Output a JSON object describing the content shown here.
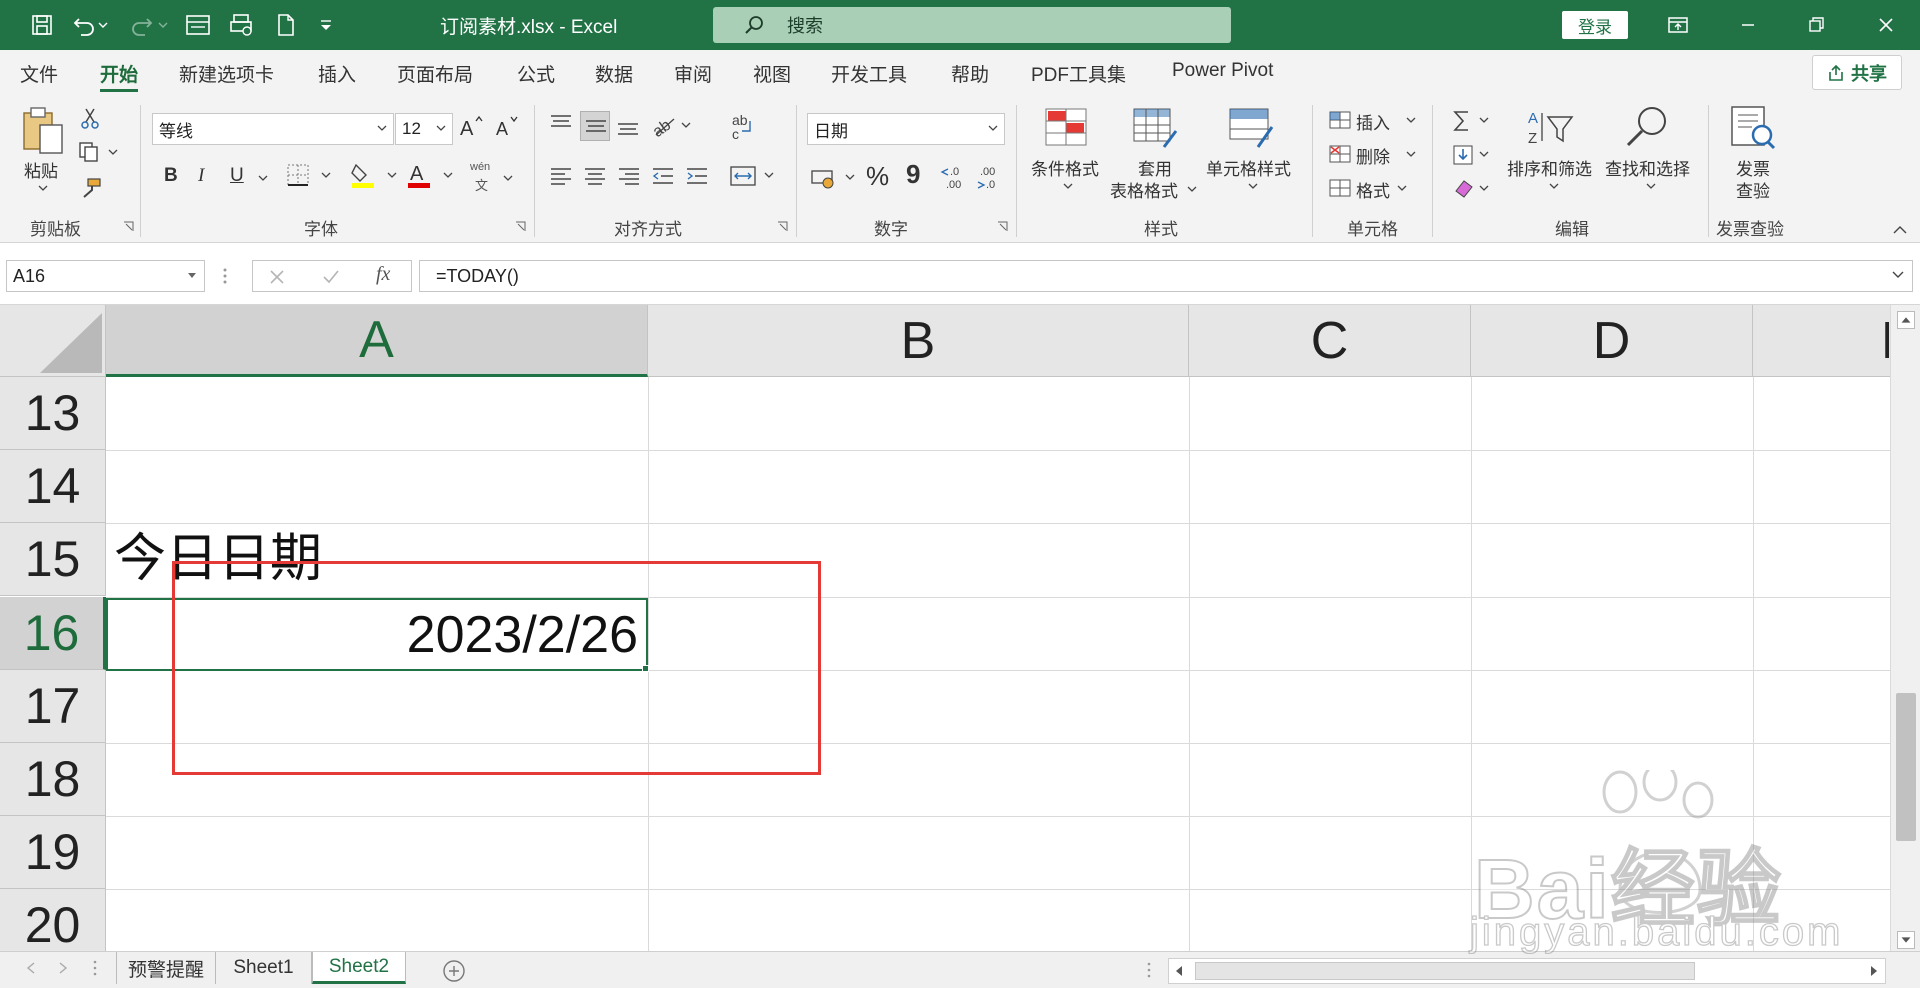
{
  "titlebar": {
    "title": "订阅素材.xlsx  -  Excel",
    "search_placeholder": "搜索",
    "login_label": "登录"
  },
  "tabs": [
    "文件",
    "开始",
    "新建选项卡",
    "插入",
    "页面布局",
    "公式",
    "数据",
    "审阅",
    "视图",
    "开发工具",
    "帮助",
    "PDF工具集",
    "Power Pivot"
  ],
  "active_tab": "开始",
  "share_label": "共享",
  "ribbon": {
    "clipboard": {
      "paste": "粘贴",
      "group": "剪贴板"
    },
    "font": {
      "name": "等线",
      "size": "12",
      "bold": "B",
      "italic": "I",
      "underline": "U",
      "font_color_glyph": "A",
      "wen": "wén",
      "wen_sub": "文",
      "group": "字体"
    },
    "alignment": {
      "group": "对齐方式"
    },
    "number": {
      "format": "日期",
      "percent": "%",
      "comma": "9",
      "group": "数字"
    },
    "styles": {
      "conditional": "条件格式",
      "table1": "套用",
      "table2": "表格格式",
      "cell_styles": "单元格样式",
      "group": "样式"
    },
    "cells": {
      "insert": "插入",
      "delete": "删除",
      "format": "格式",
      "group": "单元格"
    },
    "editing": {
      "sort": "排序和筛选",
      "find": "查找和选择",
      "group": "编辑"
    },
    "invoice": {
      "line1": "发票",
      "line2": "查验",
      "group": "发票查验"
    }
  },
  "formula_bar": {
    "name_box": "A16",
    "formula": "=TODAY()",
    "fx": "fx"
  },
  "grid": {
    "columns": [
      "A",
      "B",
      "C",
      "D",
      "E"
    ],
    "rows": [
      "13",
      "14",
      "15",
      "16",
      "17",
      "18",
      "19",
      "20"
    ],
    "selected_cell": "A16",
    "cells": {
      "A15": "今日日期",
      "A16": "2023/2/26"
    }
  },
  "sheets": [
    "预警提醒",
    "Sheet1",
    "Sheet2"
  ],
  "active_sheet": "Sheet2",
  "watermark": {
    "brand": "Bai经验",
    "url": "jingyan.baidu.com"
  },
  "colors": {
    "accent": "#217346",
    "highlight": "#e53935"
  }
}
